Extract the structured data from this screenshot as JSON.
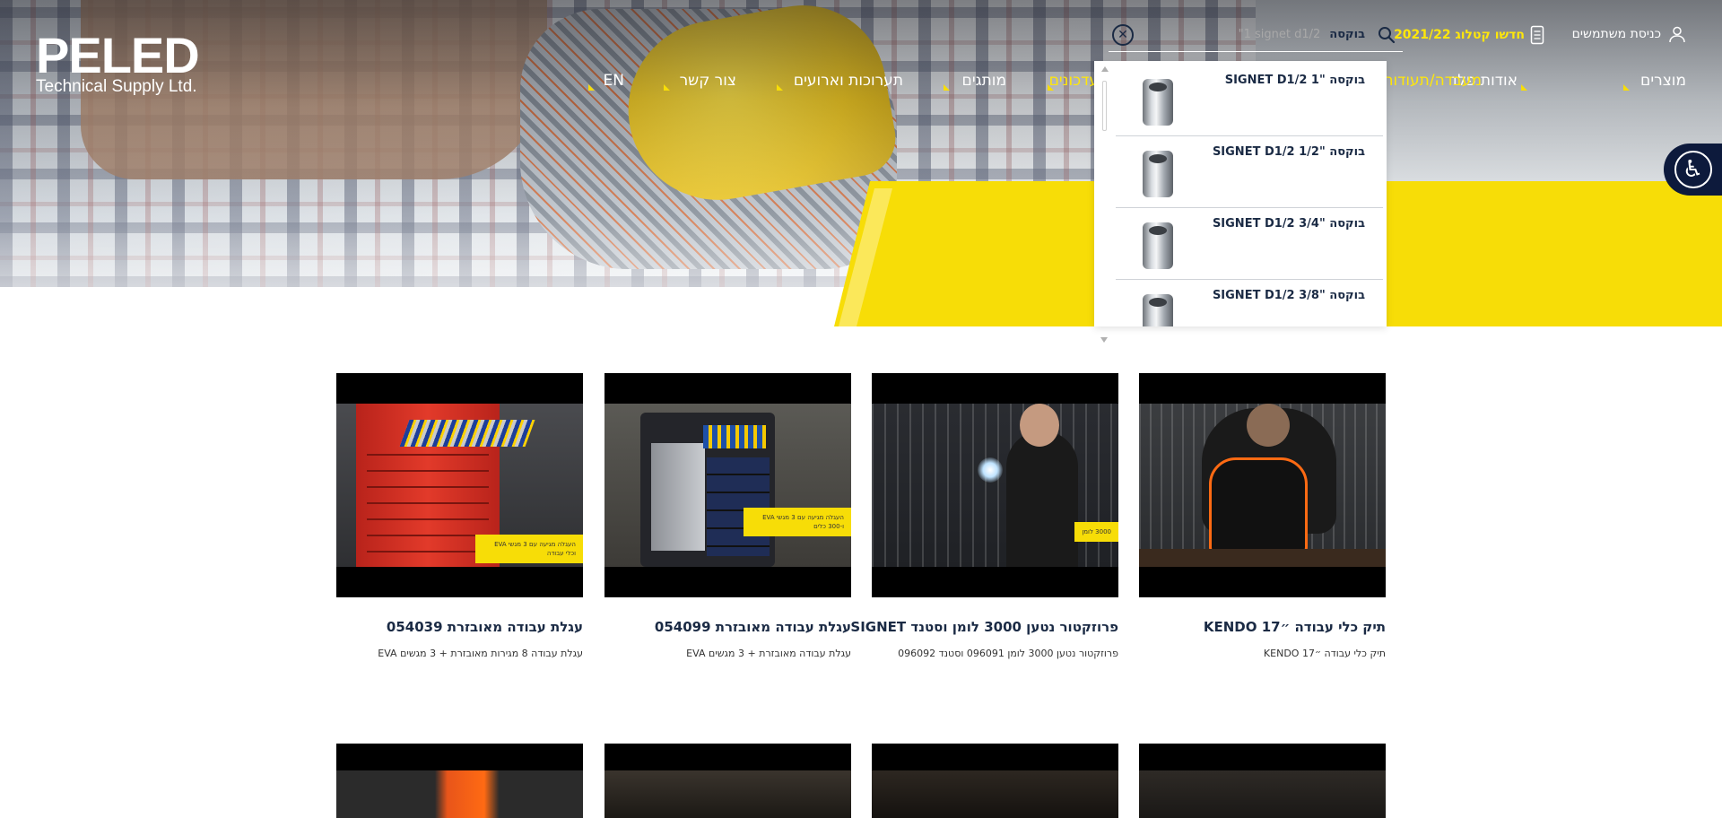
{
  "logo": {
    "name": "PELED",
    "subtitle": "Technical Supply Ltd."
  },
  "topbar": {
    "login_label": "כניסת משתמשים",
    "catalog_label": "חדשו קטלוג 2021/22"
  },
  "search": {
    "query": "בוקסה",
    "placeholder_text": "\"1 signet d1/2",
    "close_icon": "close-circle-icon",
    "search_icon": "search-icon"
  },
  "nav": {
    "items": [
      {
        "label": "מוצרים",
        "active": false
      },
      {
        "label": "אודות פלד",
        "active": false
      },
      {
        "label": "מעבדה/תעודות",
        "active": true
      },
      {
        "label": "עדכונים",
        "active": true
      },
      {
        "label": "מותגים",
        "active": false
      },
      {
        "label": "תערוכות וארועים",
        "active": false
      },
      {
        "label": "צור קשר",
        "active": false
      },
      {
        "label": "EN",
        "active": false
      }
    ]
  },
  "dropdown": {
    "results": [
      {
        "title": "בוקסה \"1 SIGNET D1/2"
      },
      {
        "title": "בוקסה \"1/2 SIGNET D1/2"
      },
      {
        "title": "בוקסה \"3/4 SIGNET D1/2"
      },
      {
        "title": "בוקסה \"3/8 SIGNET D1/2"
      }
    ]
  },
  "videos": [
    {
      "title": "תיק כלי עבודה ״17 KENDO",
      "subtitle": "תיק כלי עבודה ״17 KENDO",
      "tag": ""
    },
    {
      "title": "פרוזקטור נטען 3000 לומן וסטנד SIGNET",
      "subtitle": "פרוזקטור נטען 3000 לומן 096091 וסטנד 096092",
      "tag": "3000 לומן"
    },
    {
      "title": "עגלת עבודה מאובזרת 054099",
      "subtitle": "עגלת עבודה מאובזרת + 3 מגשים EVA",
      "tag": "העגלה מגיעה עם 3 מגשי EVA ו-300 כלים"
    },
    {
      "title": "עגלת עבודה מאובזרת 054039",
      "subtitle": "עגלת עבודה 8 מגירות מאובזרת + 3 מגשים EVA",
      "tag": "העגלה מגיעה עם 3 מגשי EVA וכלי עבודה"
    }
  ],
  "colors": {
    "accent_yellow": "#f7dd07",
    "navy": "#1a2a44",
    "a11y_bg": "#0d1a3c"
  },
  "accessibility": {
    "icon": "wheelchair-icon"
  }
}
